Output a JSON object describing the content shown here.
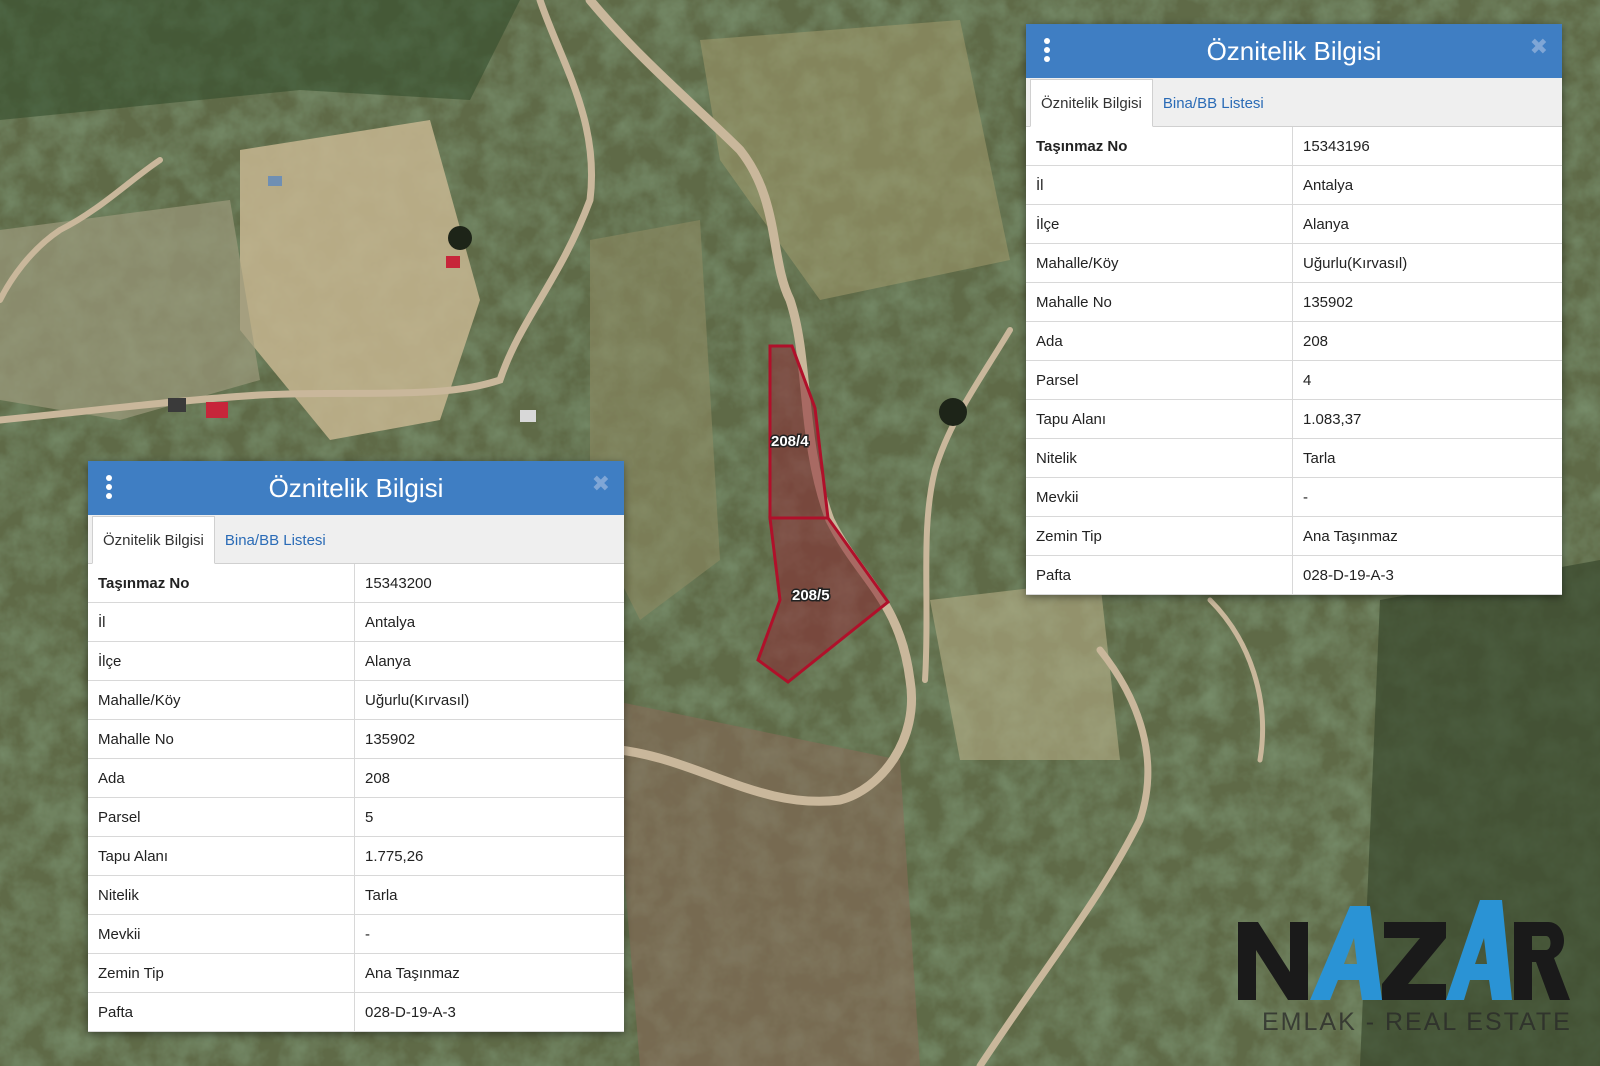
{
  "panels": [
    {
      "title": "Öznitelik Bilgisi",
      "tabs": [
        "Öznitelik Bilgisi",
        "Bina/BB Listesi"
      ],
      "rows": [
        {
          "key": "Taşınmaz No",
          "value": "15343196"
        },
        {
          "key": "İl",
          "value": "Antalya"
        },
        {
          "key": "İlçe",
          "value": "Alanya"
        },
        {
          "key": "Mahalle/Köy",
          "value": "Uğurlu(Kırvasıl)"
        },
        {
          "key": "Mahalle No",
          "value": "135902"
        },
        {
          "key": "Ada",
          "value": "208"
        },
        {
          "key": "Parsel",
          "value": "4"
        },
        {
          "key": "Tapu Alanı",
          "value": "1.083,37"
        },
        {
          "key": "Nitelik",
          "value": "Tarla"
        },
        {
          "key": "Mevkii",
          "value": "-"
        },
        {
          "key": "Zemin Tip",
          "value": "Ana Taşınmaz"
        },
        {
          "key": "Pafta",
          "value": "028-D-19-A-3"
        }
      ]
    },
    {
      "title": "Öznitelik Bilgisi",
      "tabs": [
        "Öznitelik Bilgisi",
        "Bina/BB Listesi"
      ],
      "rows": [
        {
          "key": "Taşınmaz No",
          "value": "15343200"
        },
        {
          "key": "İl",
          "value": "Antalya"
        },
        {
          "key": "İlçe",
          "value": "Alanya"
        },
        {
          "key": "Mahalle/Köy",
          "value": "Uğurlu(Kırvasıl)"
        },
        {
          "key": "Mahalle No",
          "value": "135902"
        },
        {
          "key": "Ada",
          "value": "208"
        },
        {
          "key": "Parsel",
          "value": "5"
        },
        {
          "key": "Tapu Alanı",
          "value": "1.775,26"
        },
        {
          "key": "Nitelik",
          "value": "Tarla"
        },
        {
          "key": "Mevkii",
          "value": "-"
        },
        {
          "key": "Zemin Tip",
          "value": "Ana Taşınmaz"
        },
        {
          "key": "Pafta",
          "value": "028-D-19-A-3"
        }
      ]
    }
  ],
  "parcels": [
    {
      "label": "208/4"
    },
    {
      "label": "208/5"
    }
  ],
  "logo": {
    "brand": "NAZAR",
    "subtitle": "EMLAK - REAL ESTATE"
  },
  "colors": {
    "header": "#3f7ec3",
    "tab_link": "#2a6bb6",
    "parcel_outline": "#b0102a",
    "logo_accent": "#2a93d5",
    "logo_dark": "#1a1a1a"
  },
  "icons": {
    "menu": "vertical-dots-icon",
    "close": "close-icon"
  }
}
